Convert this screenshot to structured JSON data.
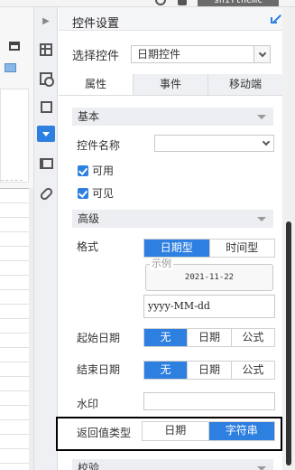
{
  "topbar": {
    "user_text": "shifthemc"
  },
  "panel": {
    "title": "控件设置",
    "select_label": "选择控件",
    "select_value": "日期控件",
    "tabs": [
      "属性",
      "事件",
      "移动端"
    ],
    "basic": {
      "title": "基本",
      "control_name_label": "控件名称",
      "control_name_value": "",
      "enabled_label": "可用",
      "visible_label": "可见"
    },
    "advanced": {
      "title": "高级",
      "format_label": "格式",
      "format_options": [
        "日期型",
        "时间型"
      ],
      "format_selected": "日期型",
      "example_legend": "示例",
      "example_value": "2021-11-22",
      "format_pattern": "yyyy-MM-dd",
      "start_date_label": "起始日期",
      "start_date_options": [
        "无",
        "日期",
        "公式"
      ],
      "end_date_label": "结束日期",
      "end_date_options": [
        "无",
        "日期",
        "公式"
      ],
      "watermark_label": "水印",
      "watermark_value": "",
      "return_type_label": "返回值类型",
      "return_type_options": [
        "日期",
        "字符串"
      ],
      "return_type_selected": "字符串"
    },
    "validation": {
      "title": "校验"
    }
  },
  "colors": {
    "accent": "#2d7fe0",
    "section_bg": "#eceef1"
  }
}
